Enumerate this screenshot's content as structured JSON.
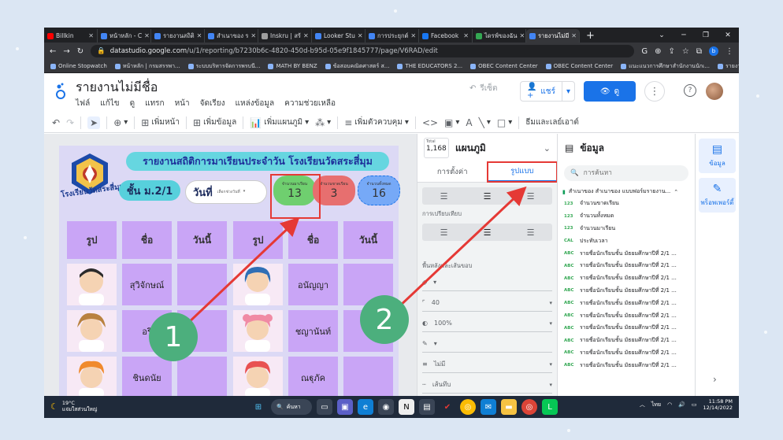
{
  "browser": {
    "tabs": [
      {
        "title": "Billkin",
        "color": "#ff0000"
      },
      {
        "title": "หน้าหลัก - C",
        "color": "#4285f4"
      },
      {
        "title": "รายงานสถิติ",
        "color": "#4285f4"
      },
      {
        "title": "สำเนาของ ร",
        "color": "#4285f4"
      },
      {
        "title": "Inskru | สร้",
        "color": "#9e9e9e"
      },
      {
        "title": "Looker Stu",
        "color": "#4285f4"
      },
      {
        "title": "การประยุกต์",
        "color": "#4285f4"
      },
      {
        "title": "Facebook",
        "color": "#1877f2"
      },
      {
        "title": "ไดรฟ์ของฉัน",
        "color": "#34a853"
      },
      {
        "title": "รายงานไม่มี",
        "color": "#4285f4"
      }
    ],
    "url_host": "datastudio.google.com",
    "url_path": "/u/1/reporting/b7230b6c-4820-450d-b95d-05e9f1845777/page/V6RAD/edit",
    "profile_letter": "b",
    "bookmarks": [
      "Online Stopwatch",
      "หน้าหลัก | กรมสรรพา...",
      "ระบบบริหารจัดการพรบนี...",
      "MATH BY BENZ",
      "ข้อสอบคณิตศาสตร์ ส...",
      "THE EDUCATORS 2...",
      "OBEC Content Center",
      "OBEC Content Center",
      "แนะแนวการศึกษาสำนักงานนักเ...",
      "รายงานสถิติการมาเรียน..."
    ]
  },
  "app": {
    "title": "รายงานไม่มีชื่อ",
    "menus": [
      "ไฟล์",
      "แก้ไข",
      "ดู",
      "แทรก",
      "หน้า",
      "จัดเรียง",
      "แหล่งข้อมูล",
      "ความช่วยเหลือ"
    ],
    "reset": "รีเซ็ต",
    "share": "แชร์",
    "view": "ดู"
  },
  "toolbar": {
    "add_page": "เพิ่มหน้า",
    "add_data": "เพิ่มข้อมูล",
    "add_chart": "เพิ่มแผนภูมิ",
    "add_control": "เพิ่มตัวควบคุม",
    "theme_layout": "ธีมและเลย์เอาต์"
  },
  "report": {
    "banner": "รายงานสถิติการมาเรียนประจำวัน โรงเรียนวัดสระสี่มุม",
    "school_name": "โรงเรียนวัดสระสี่มุม",
    "class": "ชั้น ม.2/1",
    "date_label": "วันที่",
    "date_placeholder": "เลือกช่วงวันที่",
    "stats": [
      {
        "label": "จำนวนมาเรียน",
        "value": "13"
      },
      {
        "label": "จำนวนขาดเรียน",
        "value": "3"
      },
      {
        "label": "จำนวนทั้งหมด",
        "value": "16"
      }
    ],
    "headers": [
      "รูป",
      "ชื่อ",
      "วันนี้",
      "รูป",
      "ชื่อ",
      "วันนี้"
    ],
    "students_left": [
      "สุวิจักษณ์",
      "อริ",
      "ชินดนัย"
    ],
    "students_right": [
      "อนัญญา",
      "ชญานันท์",
      "ณฐุภัค"
    ]
  },
  "annotations": {
    "step1": "1",
    "step2": "2"
  },
  "props": {
    "total_label": "Total",
    "total_value": "1,168",
    "chart_type": "แผนภูมิ",
    "tab_setup": "การตั้งค่า",
    "tab_style": "รูปแบบ",
    "align_label": "การเปรียบเทียบ",
    "bg_border_label": "พื้นหลังและเส้นขอบ",
    "opacity_value": "40",
    "opacity2_value": "100%",
    "border_none": "ไม่มี",
    "border_type": "เส้นทึบ"
  },
  "data_panel": {
    "title": "ข้อมูล",
    "search_placeholder": "การค้นหา",
    "source": "สำเนาของ สำเนาของ แบบฟอร์มรายงาน...",
    "fields": [
      {
        "type": "123",
        "name": "จำนวนขาดเรียน"
      },
      {
        "type": "123",
        "name": "จำนวนทั้งหมด"
      },
      {
        "type": "123",
        "name": "จำนวนมาเรียน"
      },
      {
        "type": "CAL",
        "name": "ประทับเวลา"
      },
      {
        "type": "ABC",
        "name": "รายชื่อนักเรียนชั้น มัธยมศึกษาปีที่ 2/1 ..."
      },
      {
        "type": "ABC",
        "name": "รายชื่อนักเรียนชั้น มัธยมศึกษาปีที่ 2/1 ..."
      },
      {
        "type": "ABC",
        "name": "รายชื่อนักเรียนชั้น มัธยมศึกษาปีที่ 2/1 ..."
      },
      {
        "type": "ABC",
        "name": "รายชื่อนักเรียนชั้น มัธยมศึกษาปีที่ 2/1 ..."
      },
      {
        "type": "ABC",
        "name": "รายชื่อนักเรียนชั้น มัธยมศึกษาปีที่ 2/1 ..."
      },
      {
        "type": "ABC",
        "name": "รายชื่อนักเรียนชั้น มัธยมศึกษาปีที่ 2/1 ..."
      },
      {
        "type": "ABC",
        "name": "รายชื่อนักเรียนชั้น มัธยมศึกษาปีที่ 2/1 ..."
      },
      {
        "type": "ABC",
        "name": "รายชื่อนักเรียนชั้น มัธยมศึกษาปีที่ 2/1 ..."
      },
      {
        "type": "ABC",
        "name": "รายชื่อนักเรียนชั้น มัธยมศึกษาปีที่ 2/1 ..."
      },
      {
        "type": "ABC",
        "name": "รายชื่อนักเรียนชั้น มัธยมศึกษาปีที่ 2/1 ..."
      }
    ]
  },
  "rail": {
    "data": "ข้อมูล",
    "properties": "พร็อพเพอร์ตี้"
  },
  "taskbar": {
    "temp": "19°C",
    "weather": "แจ่มใสส่วนใหญ่",
    "search": "ค้นหา",
    "lang": "ไทย",
    "time": "11:58 PM",
    "date": "12/14/2022"
  },
  "colors": {
    "accent": "#1a73e8",
    "highlight": "#e53935",
    "badge": "#4caf7d"
  }
}
